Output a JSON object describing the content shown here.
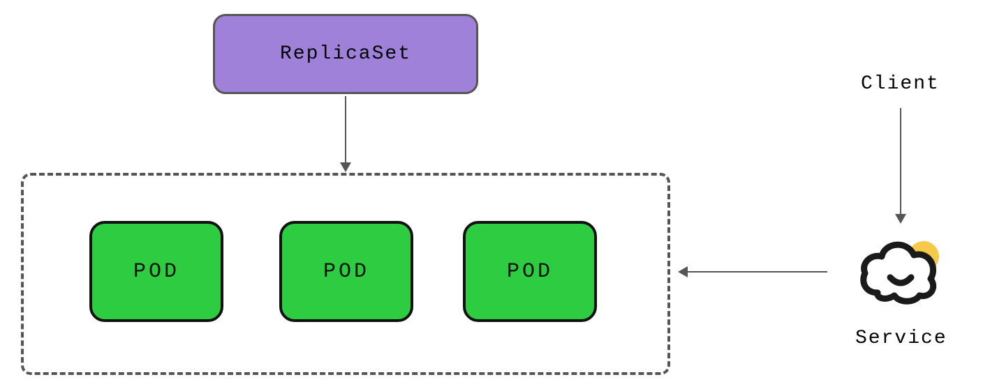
{
  "diagram": {
    "replicaset_label": "ReplicaSet",
    "pods": [
      "POD",
      "POD",
      "POD"
    ],
    "client_label": "Client",
    "service_label": "Service",
    "colors": {
      "replicaset_bg": "#a081d9",
      "pod_bg": "#2ecc40",
      "border": "#555555",
      "pod_border": "#111111",
      "sun_accent": "#f7c948",
      "cloud_stroke": "#1a1a1a"
    }
  }
}
